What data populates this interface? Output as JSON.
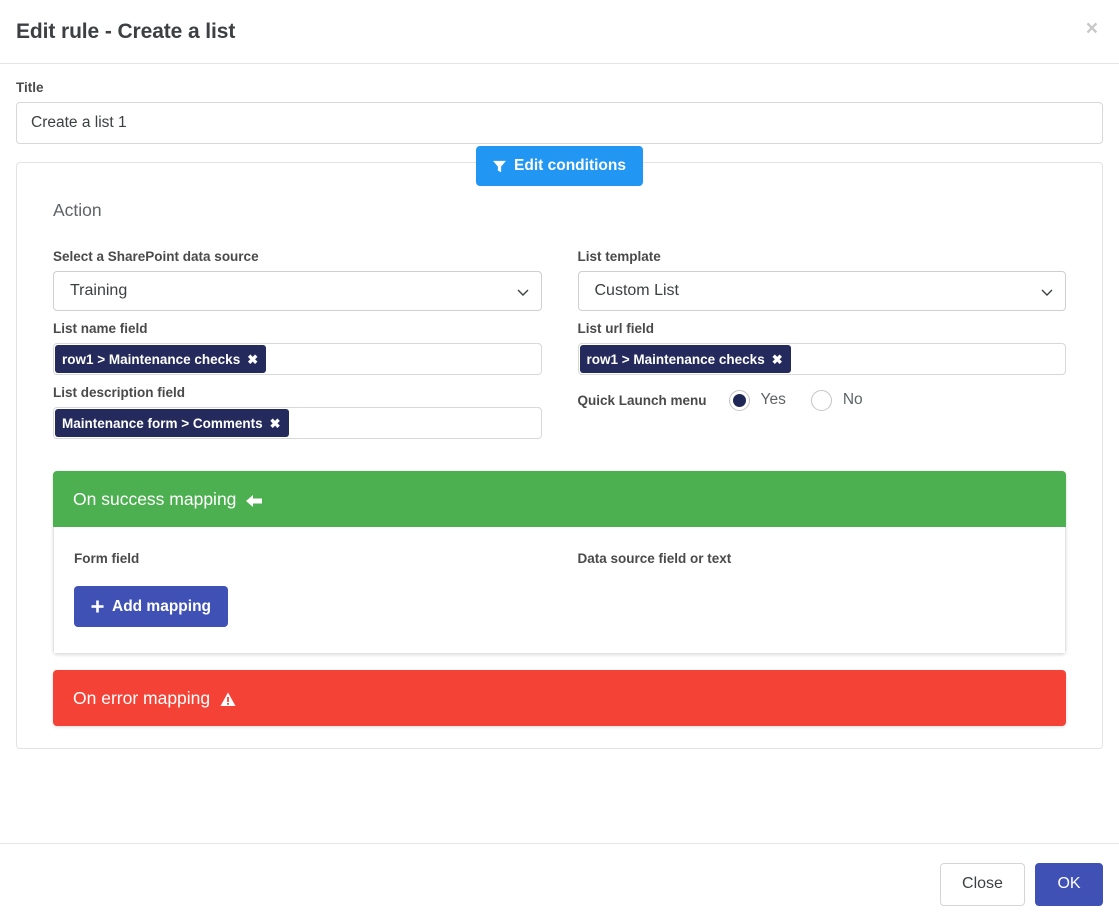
{
  "header": {
    "title": "Edit rule - Create a list",
    "close_icon": "close-icon",
    "close_glyph": "×"
  },
  "form": {
    "title_label": "Title",
    "title_value": "Create a list 1",
    "title_placeholder": "Title"
  },
  "action_panel": {
    "edit_conditions_label": "Edit conditions",
    "edit_conditions_icon": "funnel-icon",
    "heading": "Action",
    "left": {
      "data_source_label": "Select a SharePoint data source",
      "data_source_value": "Training",
      "data_source_options": [
        "Training"
      ],
      "list_name_label": "List name field",
      "list_name_chip": "row1 > Maintenance checks",
      "list_description_label": "List description field",
      "list_description_chip": "Maintenance form > Comments",
      "chip_remove_glyph": "✖"
    },
    "right": {
      "list_template_label": "List template",
      "list_template_value": "Custom List",
      "list_template_options": [
        "Custom List"
      ],
      "list_url_label": "List url field",
      "list_url_chip": "row1 > Maintenance checks",
      "quick_launch_label": "Quick Launch menu",
      "quick_launch_options": [
        {
          "label": "Yes",
          "selected": true
        },
        {
          "label": "No",
          "selected": false
        }
      ]
    }
  },
  "success_mapping": {
    "title": "On success mapping",
    "icon": "arrow-left-icon",
    "col_form_field": "Form field",
    "col_data_source": "Data source field or text",
    "add_mapping_label": "Add mapping",
    "add_mapping_icon": "plus-icon"
  },
  "error_mapping": {
    "title": "On error mapping",
    "icon": "warning-triangle-icon"
  },
  "footer": {
    "close_label": "Close",
    "ok_label": "OK"
  },
  "colors": {
    "accent_blue": "#2196F3",
    "indigo": "#3F51B5",
    "success_green": "#4CAF50",
    "error_red": "#F44336",
    "chip_navy": "#242B5C"
  }
}
